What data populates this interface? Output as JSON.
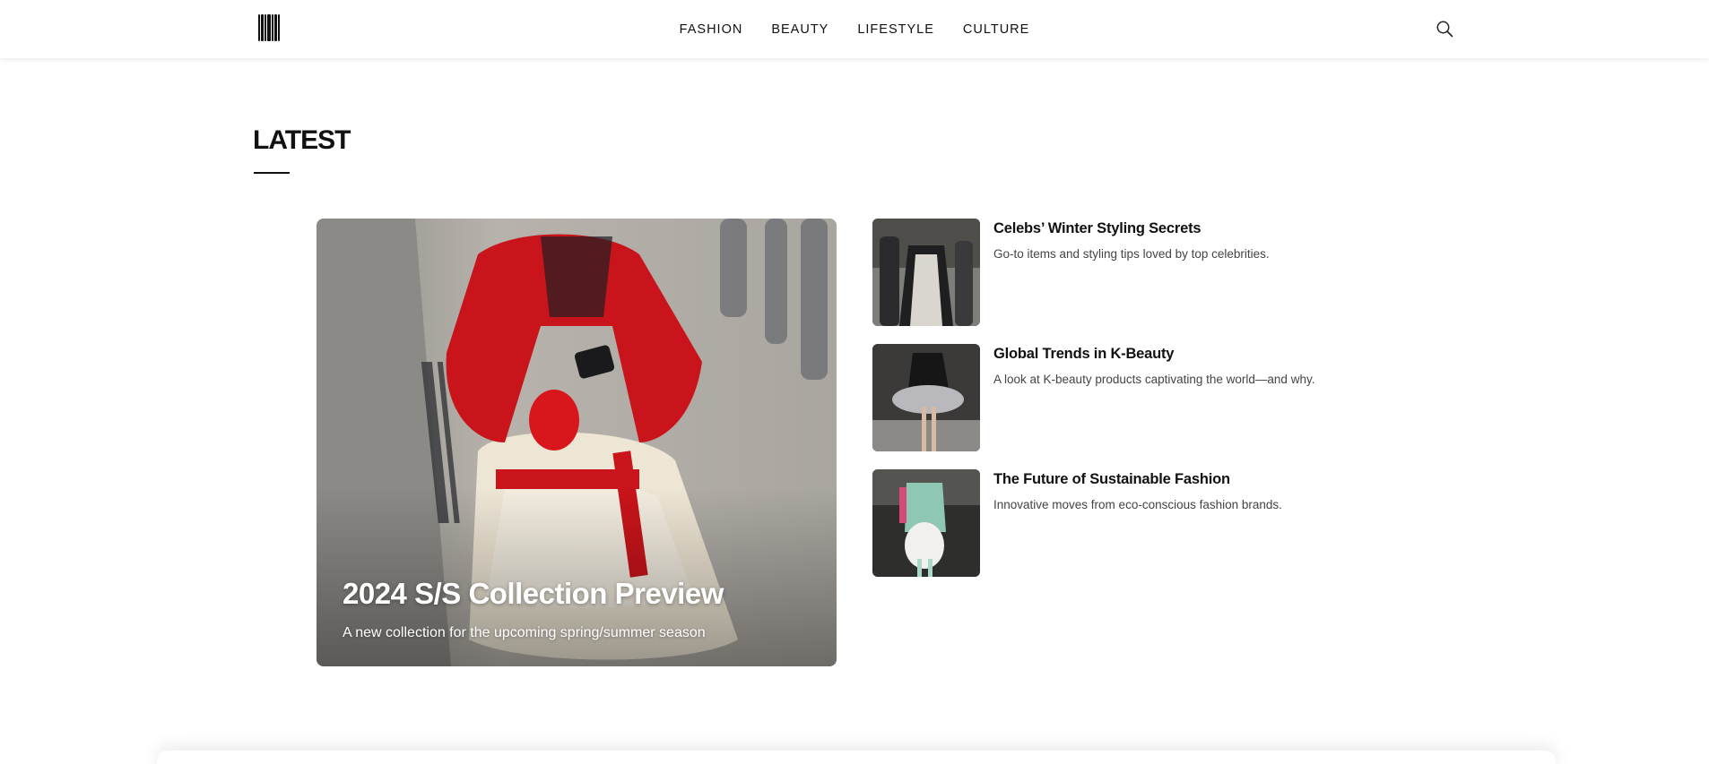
{
  "nav": {
    "items": [
      "FASHION",
      "BEAUTY",
      "LIFESTYLE",
      "CULTURE"
    ]
  },
  "icons": {
    "logo": "brand-logo-icon",
    "search": "search-icon"
  },
  "section": {
    "title": "LATEST"
  },
  "hero": {
    "title": "2024 S/S Collection Preview",
    "subtitle": "A new collection for the upcoming spring/summer season"
  },
  "articles": [
    {
      "title": "Celebs’ Winter Styling Secrets",
      "description": "Go-to items and styling tips loved by top celebrities."
    },
    {
      "title": "Global Trends in K-Beauty",
      "description": "A look at K-beauty products captivating the world—and why."
    },
    {
      "title": "The Future of Sustainable Fashion",
      "description": "Innovative moves from eco-conscious fashion brands."
    }
  ],
  "colors": {
    "text": "#111111",
    "secondary_text": "#444444",
    "background": "#ffffff"
  }
}
